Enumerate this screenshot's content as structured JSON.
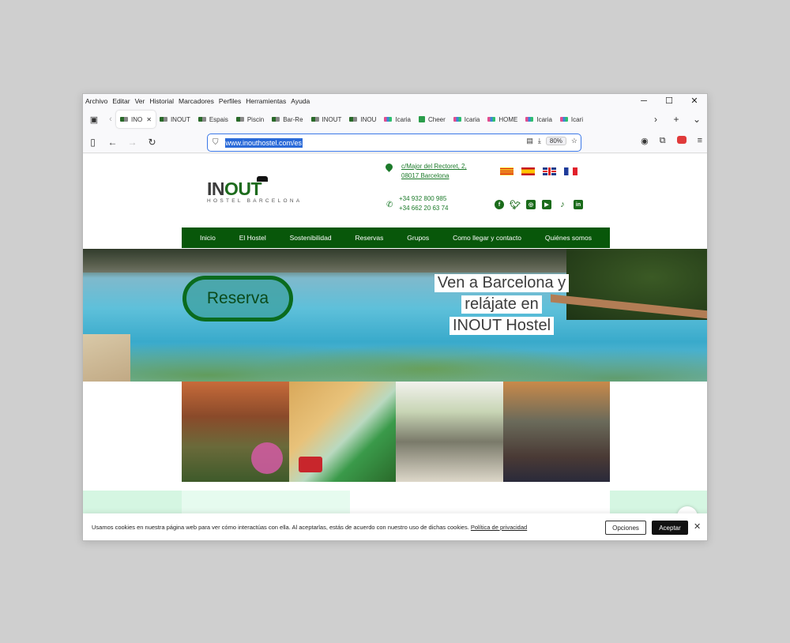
{
  "menubar": [
    "Archivo",
    "Editar",
    "Ver",
    "Historial",
    "Marcadores",
    "Perfiles",
    "Herramientas",
    "Ayuda"
  ],
  "tabs": [
    {
      "label": "INO",
      "icon": "inout",
      "active": true
    },
    {
      "label": "INOUT",
      "icon": "inout"
    },
    {
      "label": "Espais",
      "icon": "inout"
    },
    {
      "label": "Piscin",
      "icon": "inout"
    },
    {
      "label": "Bar-Re",
      "icon": "inout"
    },
    {
      "label": "INOUT",
      "icon": "inout"
    },
    {
      "label": "INOU",
      "icon": "inout"
    },
    {
      "label": "Icaria",
      "icon": "icaria"
    },
    {
      "label": "Cheer",
      "icon": "cheer"
    },
    {
      "label": "Icaria",
      "icon": "icaria"
    },
    {
      "label": "HOME",
      "icon": "icaria"
    },
    {
      "label": "Icaria",
      "icon": "icaria"
    },
    {
      "label": "Icari",
      "icon": "icaria"
    }
  ],
  "url": "www.inouthostel.com/es",
  "zoom": "80%",
  "logo": {
    "main_a": "IN",
    "main_b": "OUT",
    "sub": "HOSTEL BARCELONA"
  },
  "address": {
    "line1": "c/Major del Rectoret, 2,",
    "line2": "08017 Barcelona"
  },
  "phones": {
    "line1": "+34 932 800 985",
    "line2": "+34 662 20 63 74"
  },
  "nav": [
    "Inicio",
    "El Hostel",
    "Sostenibilidad",
    "Reservas",
    "Grupos",
    "Como llegar y contacto",
    "Quiénes somos"
  ],
  "hero": {
    "button": "Reserva",
    "tagline": [
      "Ven a Barcelona y",
      "relájate en",
      "INOUT  Hostel"
    ]
  },
  "cookie": {
    "text": "Usamos cookies en nuestra página web para ver cómo interactúas con ella. Al aceptarlas, estás de acuerdo con nuestro uso de dichas cookies.",
    "link": "Política de privacidad",
    "options": "Opciones",
    "accept": "Aceptar"
  },
  "colors": {
    "brand_green": "#08570a",
    "accent_blue": "#3b78e7"
  }
}
